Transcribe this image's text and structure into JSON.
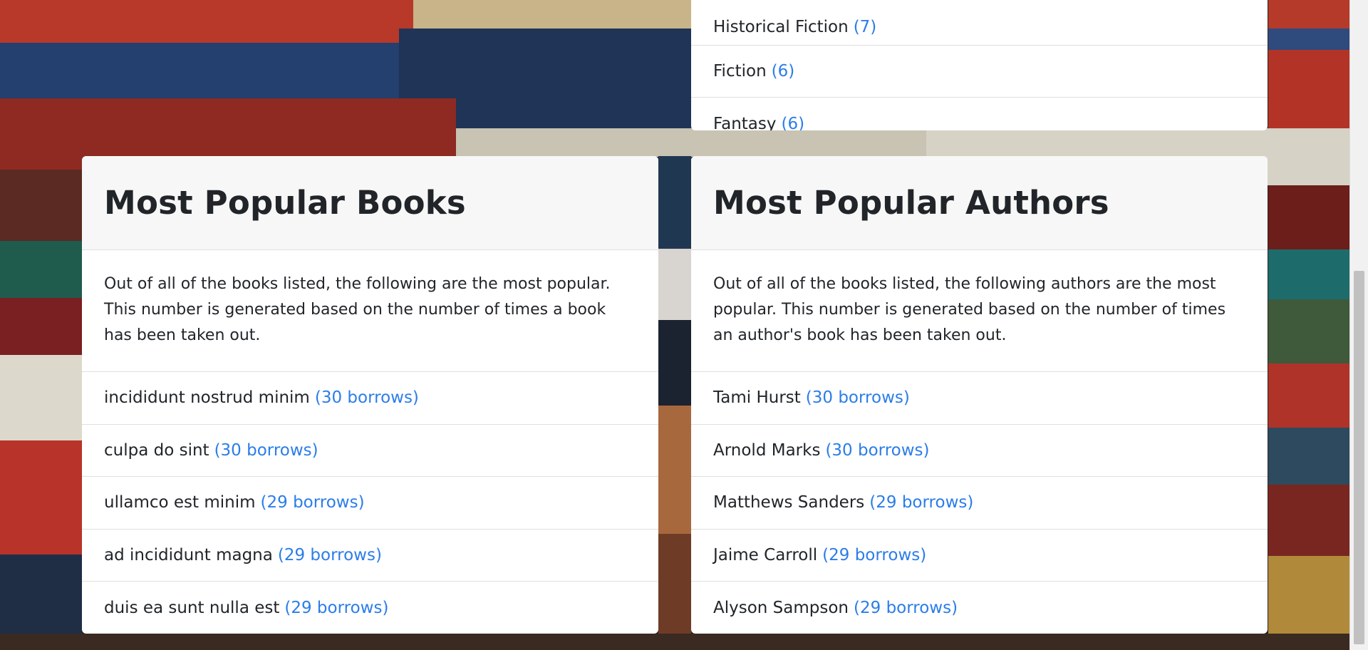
{
  "genres_card": {
    "items": [
      {
        "name": "Historical Fiction",
        "count": "(7)"
      },
      {
        "name": "Fiction",
        "count": "(6)"
      },
      {
        "name": "Fantasy",
        "count": "(6)"
      }
    ]
  },
  "books_card": {
    "title": "Most Popular Books",
    "description": "Out of all of the books listed, the following are the most popular. This number is generated based on the number of times a book has been taken out.",
    "items": [
      {
        "name": "incididunt nostrud minim",
        "count": "(30 borrows)"
      },
      {
        "name": "culpa do sint",
        "count": "(30 borrows)"
      },
      {
        "name": "ullamco est minim",
        "count": "(29 borrows)"
      },
      {
        "name": "ad incididunt magna",
        "count": "(29 borrows)"
      },
      {
        "name": "duis ea sunt nulla est",
        "count": "(29 borrows)"
      }
    ]
  },
  "authors_card": {
    "title": "Most Popular Authors",
    "description": "Out of all of the books listed, the following authors are the most popular. This number is generated based on the number of times an author's book has been taken out.",
    "items": [
      {
        "name": "Tami Hurst",
        "count": "(30 borrows)"
      },
      {
        "name": "Arnold Marks",
        "count": "(30 borrows)"
      },
      {
        "name": "Matthews Sanders",
        "count": "(29 borrows)"
      },
      {
        "name": "Jaime Carroll",
        "count": "(29 borrows)"
      },
      {
        "name": "Alyson Sampson",
        "count": "(29 borrows)"
      }
    ]
  },
  "colors": {
    "accent": "#2b7de9",
    "card_header_bg": "#f7f7f7"
  }
}
